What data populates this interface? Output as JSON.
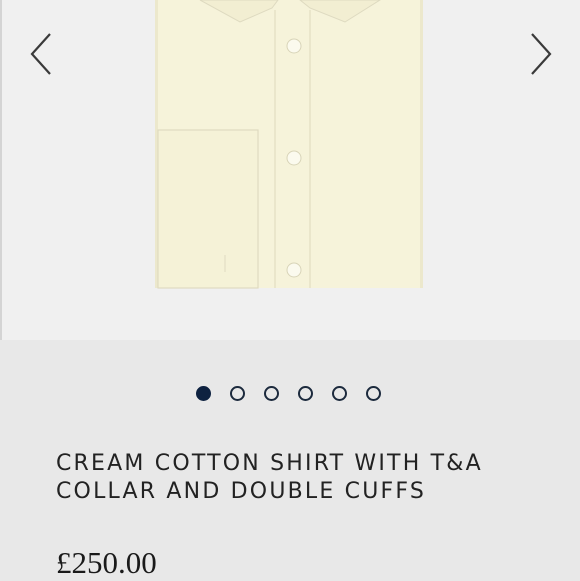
{
  "gallery": {
    "prev_icon": "chevron-left-icon",
    "next_icon": "chevron-right-icon",
    "image_alt": "cream shirt image",
    "dots_total": 6,
    "active_dot": 1
  },
  "product": {
    "title_line1": "CREAM COTTON SHIRT WITH T&A",
    "title_line2": "COLLAR AND DOUBLE CUFFS",
    "price": "£250.00"
  },
  "colors": {
    "shirt": "#f7f4db",
    "dot_active": "#0e2240",
    "background": "#e8e8e8"
  }
}
